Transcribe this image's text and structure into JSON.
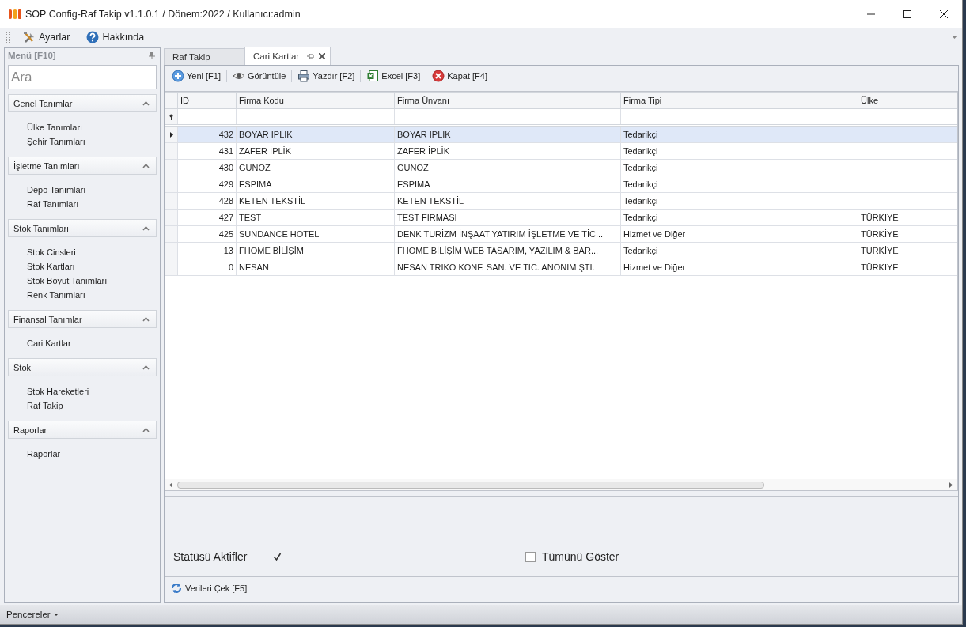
{
  "window": {
    "title": "SOP Config-Raf Takip v1.1.0.1 / Dönem:2022 / Kullanıcı:admin"
  },
  "menu_bar": [
    {
      "label": "Ayarlar",
      "kind": "tools"
    },
    {
      "label": "Hakkında",
      "kind": "help"
    }
  ],
  "sidebar": {
    "title": "Menü [F10]",
    "search": {
      "placeholder": "Ara"
    },
    "groups": [
      {
        "label": "Genel Tanımlar",
        "expanded": true,
        "items": [
          "Ülke Tanımları",
          "Şehir Tanımları"
        ]
      },
      {
        "label": "İşletme Tanımları",
        "expanded": true,
        "items": [
          "Depo Tanımları",
          "Raf Tanımları"
        ]
      },
      {
        "label": "Stok Tanımları",
        "expanded": true,
        "items": [
          "Stok Cinsleri",
          "Stok Kartları",
          "Stok Boyut Tanımları",
          "Renk Tanımları"
        ]
      },
      {
        "label": "Finansal Tanımlar",
        "expanded": true,
        "items": [
          "Cari Kartlar"
        ]
      },
      {
        "label": "Stok",
        "expanded": true,
        "items": [
          "Stok Hareketleri",
          "Raf Takip"
        ]
      },
      {
        "label": "Raporlar",
        "expanded": true,
        "items": [
          "Raporlar"
        ]
      }
    ]
  },
  "tabs": [
    {
      "label": "Raf Takip",
      "selected": false
    },
    {
      "label": "Cari Kartlar",
      "selected": true
    }
  ],
  "toolbar": [
    {
      "label": "Yeni [F1]",
      "kind": "add"
    },
    {
      "label": "Görüntüle",
      "kind": "view"
    },
    {
      "label": "Yazdır [F2]",
      "kind": "print"
    },
    {
      "label": "Excel [F3]",
      "kind": "excel"
    },
    {
      "label": "Kapat [F4]",
      "kind": "close"
    }
  ],
  "table": {
    "columns": [
      "ID",
      "Firma Kodu",
      "Firma Ünvanı",
      "Firma Tipi",
      "Ülke"
    ],
    "rows": [
      {
        "cells": [
          "432",
          "BOYAR İPLİK",
          "BOYAR İPLİK",
          "Tedarikçi",
          ""
        ],
        "selected": true
      },
      {
        "cells": [
          "431",
          "ZAFER İPLİK",
          "ZAFER İPLİK",
          "Tedarikçi",
          ""
        ],
        "selected": false
      },
      {
        "cells": [
          "430",
          "GÜNÖZ",
          "GÜNÖZ",
          "Tedarikçi",
          ""
        ],
        "selected": false
      },
      {
        "cells": [
          "429",
          "ESPIMA",
          "ESPIMA",
          "Tedarikçi",
          ""
        ],
        "selected": false
      },
      {
        "cells": [
          "428",
          "KETEN TEKSTİL",
          "KETEN TEKSTİL",
          "Tedarikçi",
          ""
        ],
        "selected": false
      },
      {
        "cells": [
          "427",
          "TEST",
          "TEST FİRMASI",
          "Tedarikçi",
          "TÜRKİYE"
        ],
        "selected": false
      },
      {
        "cells": [
          "425",
          "SUNDANCE HOTEL",
          "DENK TURİZM İNŞAAT YATIRIM İŞLETME VE TİC...",
          "Hizmet ve Diğer",
          "TÜRKİYE"
        ],
        "selected": false
      },
      {
        "cells": [
          "13",
          "FHOME BİLİŞİM",
          "FHOME BİLİŞİM WEB TASARIM, YAZILIM & BAR...",
          "Tedarikçi",
          "TÜRKİYE"
        ],
        "selected": false
      },
      {
        "cells": [
          "0",
          "NESAN",
          "NESAN TRİKO KONF. SAN. VE TİC. ANONİM ŞTİ.",
          "Hizmet ve Diğer",
          "TÜRKİYE"
        ],
        "selected": false
      }
    ]
  },
  "filters": [
    {
      "label": "Statüsü Aktifler",
      "checked": true,
      "kind": "label-first"
    },
    {
      "label": "Tümünü Göster",
      "checked": false,
      "kind": "box-first"
    }
  ],
  "refresh_button": {
    "label": "Verileri Çek [F5]"
  },
  "status_bar": {
    "label": "Pencereler"
  }
}
